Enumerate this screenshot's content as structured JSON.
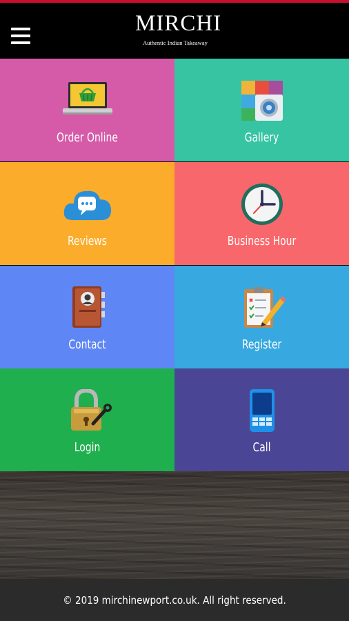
{
  "header": {
    "menu_icon": "hamburger-menu-icon",
    "logo_text": "MIRCHI",
    "logo_tagline": "Authentic Indian Takeaway"
  },
  "tiles": [
    {
      "label": "Order Online",
      "icon": "laptop-shopping-basket-icon",
      "color": "#d55ba9"
    },
    {
      "label": "Gallery",
      "icon": "photo-gallery-icon",
      "color": "#36c4a3"
    },
    {
      "label": "Reviews",
      "icon": "chat-cloud-icon",
      "color": "#fbac2a"
    },
    {
      "label": "Business Hour",
      "icon": "clock-icon",
      "color": "#f8676b"
    },
    {
      "label": "Contact",
      "icon": "address-book-icon",
      "color": "#5f86f5"
    },
    {
      "label": "Register",
      "icon": "clipboard-pencil-icon",
      "color": "#37a9e0"
    },
    {
      "label": "Login",
      "icon": "padlock-key-icon",
      "color": "#1faf4f"
    },
    {
      "label": "Call",
      "icon": "mobile-phone-icon",
      "color": "#4b4595"
    }
  ],
  "footer": {
    "copyright": "© 2019 mirchinewport.co.uk. All right reserved."
  },
  "colors": {
    "header_bg": "#000000",
    "top_stripe": "#c8102e",
    "footer_bg": "#2b2b2b"
  }
}
